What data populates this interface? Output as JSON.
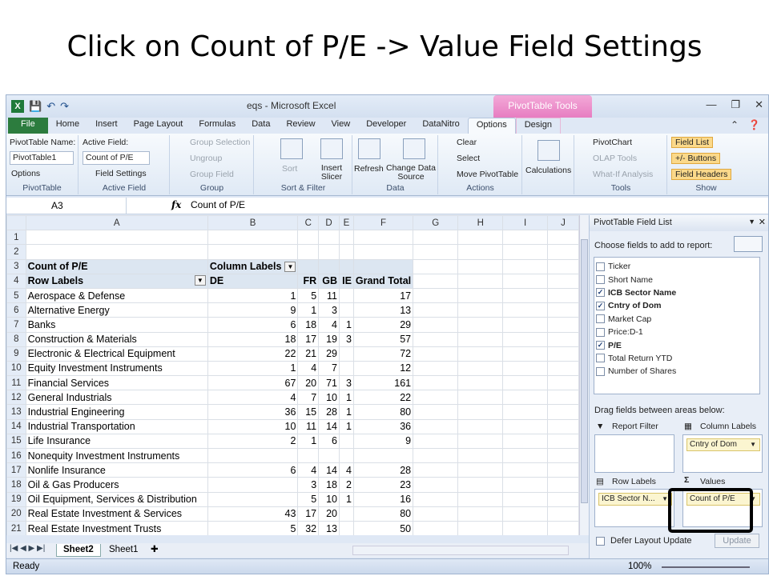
{
  "slide_title": "Click on Count of P/E -> Value Field Settings",
  "window": {
    "title": "eqs  -  Microsoft Excel",
    "context_tab": "PivotTable Tools"
  },
  "tabs": [
    "File",
    "Home",
    "Insert",
    "Page Layout",
    "Formulas",
    "Data",
    "Review",
    "View",
    "Developer",
    "DataNitro",
    "Options",
    "Design"
  ],
  "active_tab": "Options",
  "ribbon": {
    "pivottable": {
      "name_label": "PivotTable Name:",
      "name_value": "PivotTable1",
      "options": "Options",
      "group": "PivotTable"
    },
    "active_field": {
      "label": "Active Field:",
      "value": "Count of P/E",
      "settings": "Field Settings",
      "group": "Active Field"
    },
    "group": {
      "selection": "Group Selection",
      "ungroup": "Ungroup",
      "field": "Group Field",
      "group": "Group"
    },
    "sort_filter": {
      "sort": "Sort",
      "insert_slicer": "Insert Slicer",
      "group": "Sort & Filter"
    },
    "data": {
      "refresh": "Refresh",
      "change_source": "Change Data Source",
      "group": "Data"
    },
    "actions": {
      "clear": "Clear",
      "select": "Select",
      "move": "Move PivotTable",
      "group": "Actions"
    },
    "calculations": {
      "label": "Calculations"
    },
    "tools": {
      "chart": "PivotChart",
      "olap": "OLAP Tools",
      "whatif": "What-If Analysis",
      "group": "Tools"
    },
    "show": {
      "field_list": "Field List",
      "buttons": "+/- Buttons",
      "headers": "Field Headers",
      "group": "Show"
    }
  },
  "formula_bar": {
    "cell": "A3",
    "fx": "fx",
    "value": "Count of P/E"
  },
  "columns": [
    "A",
    "B",
    "C",
    "D",
    "E",
    "F",
    "G",
    "H",
    "I",
    "J"
  ],
  "rows": [
    {
      "n": "1",
      "a": "",
      "b": "",
      "c": "",
      "d": "",
      "e": "",
      "f": ""
    },
    {
      "n": "2",
      "a": "",
      "b": "",
      "c": "",
      "d": "",
      "e": "",
      "f": ""
    },
    {
      "n": "3",
      "a": "Count of P/E",
      "b": "Column Labels",
      "c": "",
      "d": "",
      "e": "",
      "f": ""
    },
    {
      "n": "4",
      "a": "Row Labels",
      "b": "DE",
      "c": "FR",
      "d": "GB",
      "e": "IE",
      "f": "Grand Total"
    },
    {
      "n": "5",
      "a": "Aerospace & Defense",
      "b": "1",
      "c": "5",
      "d": "11",
      "e": "",
      "f": "17"
    },
    {
      "n": "6",
      "a": "Alternative Energy",
      "b": "9",
      "c": "1",
      "d": "3",
      "e": "",
      "f": "13"
    },
    {
      "n": "7",
      "a": "Banks",
      "b": "6",
      "c": "18",
      "d": "4",
      "e": "1",
      "f": "29"
    },
    {
      "n": "8",
      "a": "Construction & Materials",
      "b": "18",
      "c": "17",
      "d": "19",
      "e": "3",
      "f": "57"
    },
    {
      "n": "9",
      "a": "Electronic & Electrical Equipment",
      "b": "22",
      "c": "21",
      "d": "29",
      "e": "",
      "f": "72"
    },
    {
      "n": "10",
      "a": "Equity Investment Instruments",
      "b": "1",
      "c": "4",
      "d": "7",
      "e": "",
      "f": "12"
    },
    {
      "n": "11",
      "a": "Financial Services",
      "b": "67",
      "c": "20",
      "d": "71",
      "e": "3",
      "f": "161"
    },
    {
      "n": "12",
      "a": "General Industrials",
      "b": "4",
      "c": "7",
      "d": "10",
      "e": "1",
      "f": "22"
    },
    {
      "n": "13",
      "a": "Industrial Engineering",
      "b": "36",
      "c": "15",
      "d": "28",
      "e": "1",
      "f": "80"
    },
    {
      "n": "14",
      "a": "Industrial Transportation",
      "b": "10",
      "c": "11",
      "d": "14",
      "e": "1",
      "f": "36"
    },
    {
      "n": "15",
      "a": "Life Insurance",
      "b": "2",
      "c": "1",
      "d": "6",
      "e": "",
      "f": "9"
    },
    {
      "n": "16",
      "a": "Nonequity Investment Instruments",
      "b": "",
      "c": "",
      "d": "",
      "e": "",
      "f": ""
    },
    {
      "n": "17",
      "a": "Nonlife Insurance",
      "b": "6",
      "c": "4",
      "d": "14",
      "e": "4",
      "f": "28"
    },
    {
      "n": "18",
      "a": "Oil & Gas Producers",
      "b": "",
      "c": "3",
      "d": "18",
      "e": "2",
      "f": "23"
    },
    {
      "n": "19",
      "a": "Oil Equipment, Services & Distribution",
      "b": "",
      "c": "5",
      "d": "10",
      "e": "1",
      "f": "16"
    },
    {
      "n": "20",
      "a": "Real Estate Investment & Services",
      "b": "43",
      "c": "17",
      "d": "20",
      "e": "",
      "f": "80"
    },
    {
      "n": "21",
      "a": "Real Estate Investment Trusts",
      "b": "5",
      "c": "32",
      "d": "13",
      "e": "",
      "f": "50"
    }
  ],
  "sheet_tabs": [
    "Sheet2",
    "Sheet1"
  ],
  "status": {
    "ready": "Ready",
    "zoom": "100%"
  },
  "field_list": {
    "title": "PivotTable Field List",
    "choose": "Choose fields to add to report:",
    "fields": [
      {
        "name": "Ticker",
        "checked": false
      },
      {
        "name": "Short Name",
        "checked": false
      },
      {
        "name": "ICB Sector Name",
        "checked": true
      },
      {
        "name": "Cntry of Dom",
        "checked": true
      },
      {
        "name": "Market Cap",
        "checked": false
      },
      {
        "name": "Price:D-1",
        "checked": false
      },
      {
        "name": "P/E",
        "checked": true
      },
      {
        "name": "Total Return YTD",
        "checked": false
      },
      {
        "name": "Number of Shares",
        "checked": false
      }
    ],
    "drag": "Drag fields between areas below:",
    "report_filter": "Report Filter",
    "column_labels": "Column Labels",
    "row_labels": "Row Labels",
    "values": "Values",
    "col_chip": "Cntry of Dom",
    "row_chip": "ICB Sector N...",
    "val_chip": "Count of P/E",
    "defer": "Defer Layout Update",
    "update": "Update"
  }
}
